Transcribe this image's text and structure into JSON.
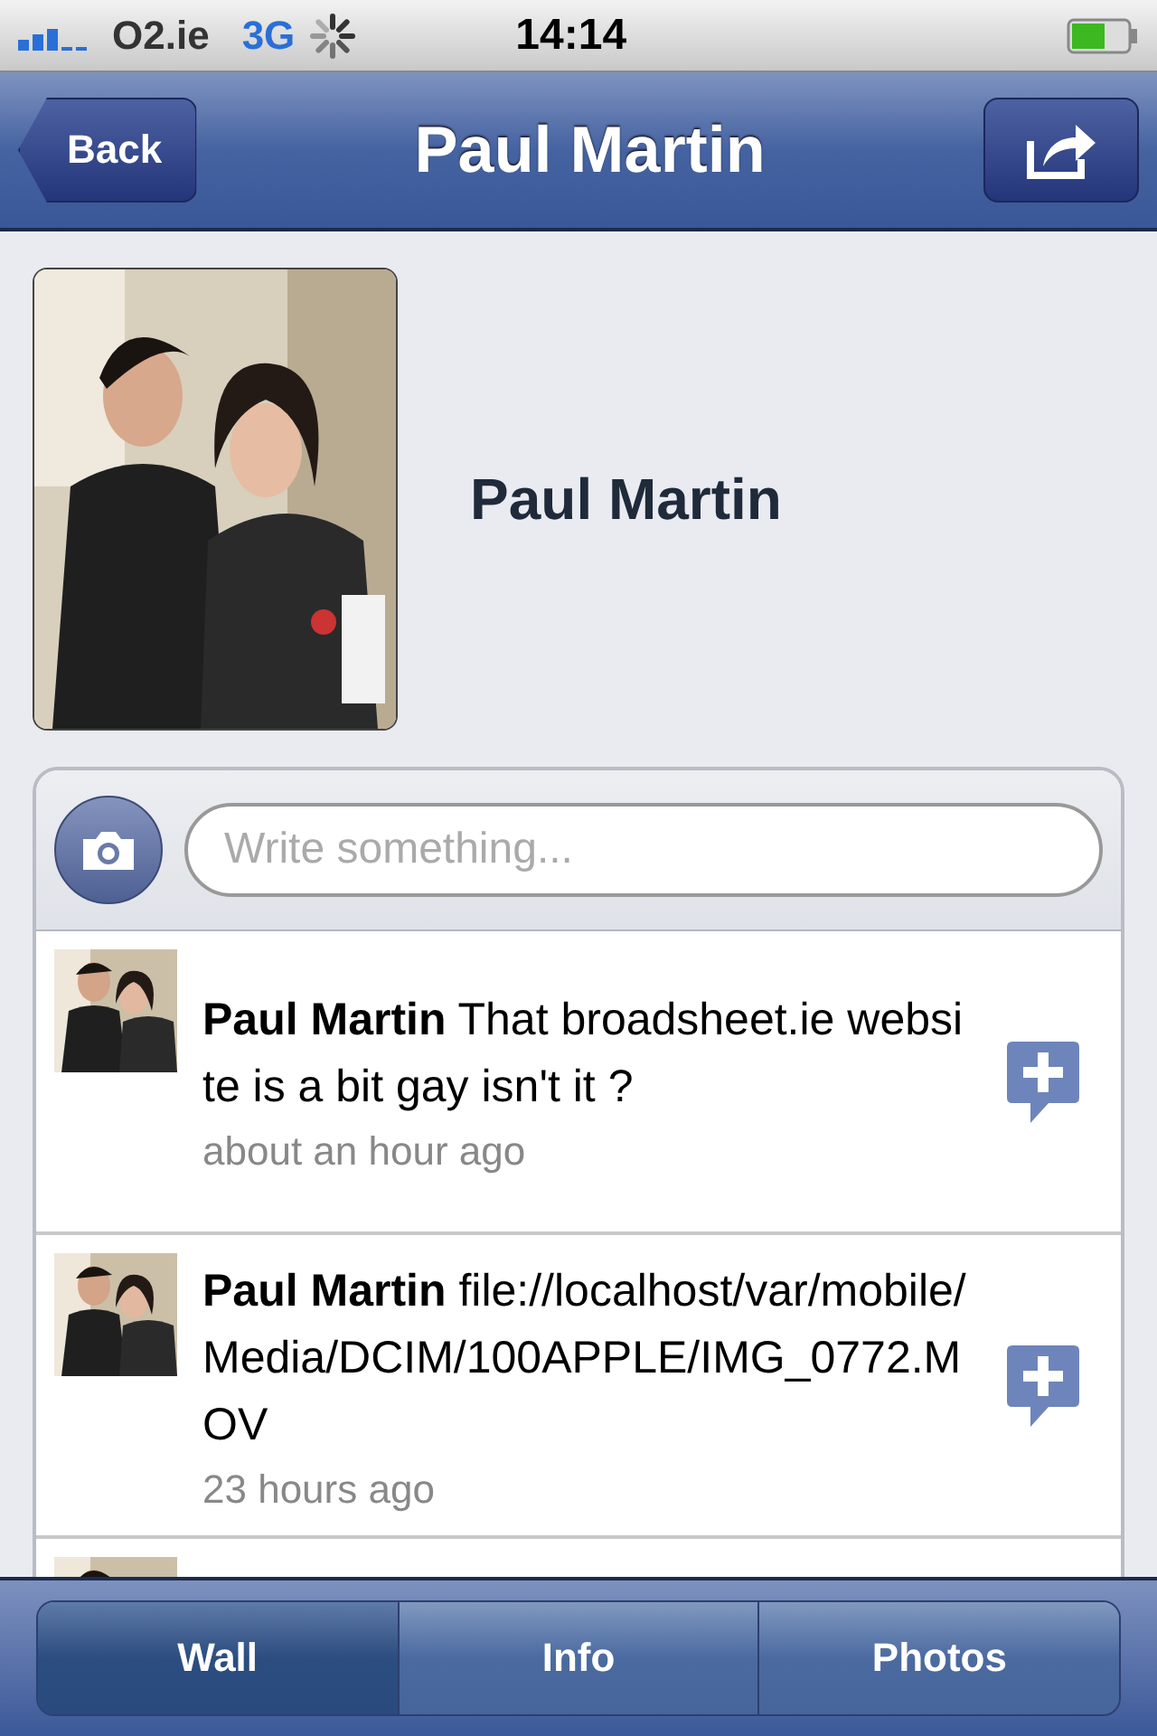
{
  "status_bar": {
    "carrier": "O2.ie",
    "network": "3G",
    "time": "14:14"
  },
  "nav_bar": {
    "back": "Back",
    "title": "Paul Martin"
  },
  "profile": {
    "name": "Paul Martin"
  },
  "composer": {
    "placeholder": "Write something..."
  },
  "posts": [
    {
      "kind": "post",
      "author": "Paul Martin",
      "text": "That broadsheet.ie website is a bit gay isn't it ?",
      "time": "about an hour ago"
    },
    {
      "kind": "post",
      "author": "Paul Martin",
      "text": "file://localhost/var/mobile/Media/DCIM/100APPLE/IMG_0772.MOV",
      "time": "23 hours ago"
    },
    {
      "kind": "picture"
    }
  ],
  "tabs": [
    {
      "label": "Wall",
      "selected": true
    },
    {
      "label": "Info",
      "selected": false
    },
    {
      "label": "Photos",
      "selected": false
    }
  ]
}
